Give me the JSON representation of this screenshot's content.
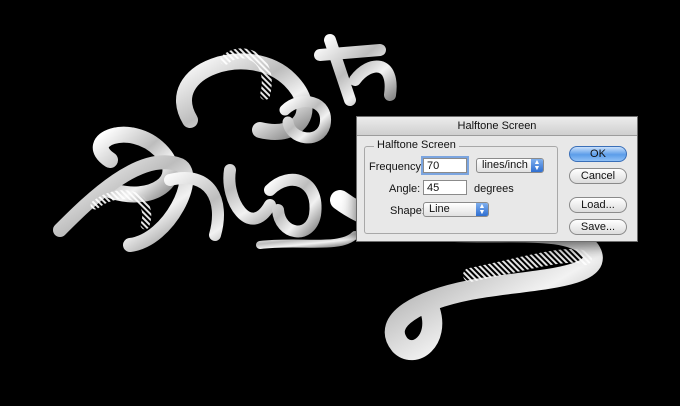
{
  "dialog": {
    "title": "Halftone Screen",
    "group_label": "Halftone Screen",
    "frequency": {
      "label": "Frequency:",
      "value": "70",
      "unit": "lines/inch"
    },
    "angle": {
      "label": "Angle:",
      "value": "45",
      "unit": "degrees"
    },
    "shape": {
      "label": "Shape:",
      "value": "Line"
    },
    "buttons": {
      "ok": "OK",
      "cancel": "Cancel",
      "load": "Load...",
      "save": "Save..."
    }
  },
  "icons": {
    "select_arrow": "up-down-arrows-icon"
  },
  "colors": {
    "background": "#000000",
    "dialog": "#e8e8e8",
    "default_button": "#5c9de9",
    "focus_ring": "#7ba5e0"
  }
}
